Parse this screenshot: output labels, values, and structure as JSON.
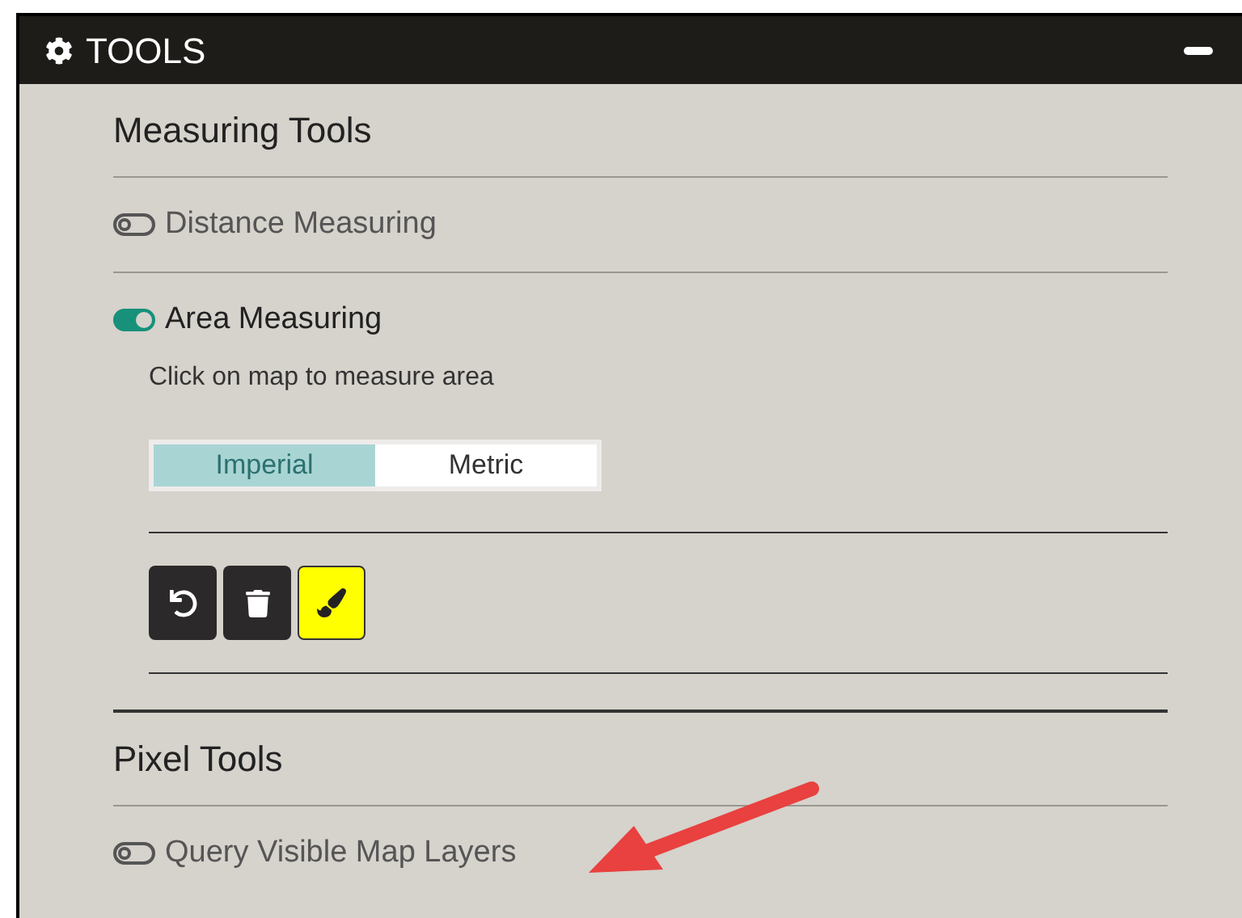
{
  "panel": {
    "title": "TOOLS"
  },
  "sections": [
    {
      "title": "Measuring Tools",
      "tools": [
        {
          "label": "Distance Measuring",
          "on": false
        },
        {
          "label": "Area Measuring",
          "on": true,
          "hint": "Click on map to measure area",
          "units": [
            {
              "label": "Imperial",
              "selected": true
            },
            {
              "label": "Metric",
              "selected": false
            }
          ],
          "actions": [
            {
              "kind": "undo",
              "active": false
            },
            {
              "kind": "delete",
              "active": false
            },
            {
              "kind": "paint",
              "active": true
            }
          ]
        }
      ]
    },
    {
      "title": "Pixel Tools",
      "tools": [
        {
          "label": "Query Visible Map Layers",
          "on": false
        }
      ]
    }
  ]
}
